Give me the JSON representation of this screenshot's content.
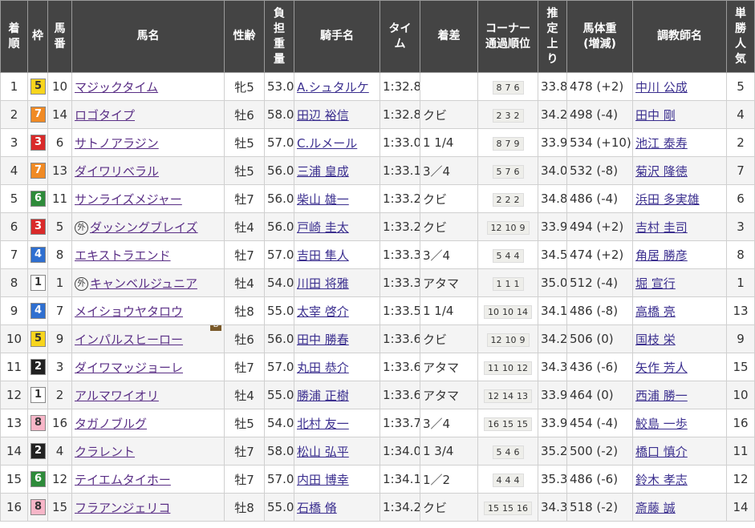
{
  "headers": {
    "rank": "着\n順",
    "waku": "枠",
    "umaban": "馬\n番",
    "horse": "馬名",
    "sexage": "性齢",
    "weight": "負\n担\n重\n量",
    "jockey": "騎手名",
    "time": "タイ\nム",
    "margin": "着差",
    "corner": "コーナー\n通過順位",
    "last3f": "推\n定\n上\nり",
    "bodyweight": "馬体重\n(増減)",
    "trainer": "調教師名",
    "pop": "単\n勝\n人\n気"
  },
  "waku_colors": {
    "1": {
      "bg": "#ffffff",
      "fg": "#333333"
    },
    "2": {
      "bg": "#222222",
      "fg": "#ffffff"
    },
    "3": {
      "bg": "#d92a2a",
      "fg": "#ffffff"
    },
    "4": {
      "bg": "#2f6fd0",
      "fg": "#ffffff"
    },
    "5": {
      "bg": "#f7d51d",
      "fg": "#333333"
    },
    "6": {
      "bg": "#2e8b3a",
      "fg": "#ffffff"
    },
    "7": {
      "bg": "#f08a24",
      "fg": "#ffffff"
    },
    "8": {
      "bg": "#f7b6c8",
      "fg": "#333333"
    }
  },
  "foreign_mark": "外",
  "blinker_mark": "B",
  "rows": [
    {
      "rank": "1",
      "waku": "5",
      "umaban": "10",
      "horse": "マジックタイム",
      "foreign": false,
      "blinker": false,
      "sexage": "牝5",
      "weight": "53.0",
      "jockey": "A.シュタルケ",
      "time": "1:32.8",
      "margin": "",
      "corner": [
        "8",
        "7",
        "6"
      ],
      "last3f": "33.8",
      "bodyweight": "478 (+2)",
      "trainer": "中川 公成",
      "pop": "5"
    },
    {
      "rank": "2",
      "waku": "7",
      "umaban": "14",
      "horse": "ロゴタイプ",
      "foreign": false,
      "blinker": false,
      "sexage": "牡6",
      "weight": "58.0",
      "jockey": "田辺 裕信",
      "time": "1:32.8",
      "margin": "クビ",
      "corner": [
        "2",
        "3",
        "2"
      ],
      "last3f": "34.2",
      "bodyweight": "498 (-4)",
      "trainer": "田中 剛",
      "pop": "4"
    },
    {
      "rank": "3",
      "waku": "3",
      "umaban": "6",
      "horse": "サトノアラジン",
      "foreign": false,
      "blinker": false,
      "sexage": "牡5",
      "weight": "57.0",
      "jockey": "C.ルメール",
      "time": "1:33.0",
      "margin": "1 1/4",
      "corner": [
        "8",
        "7",
        "9"
      ],
      "last3f": "33.9",
      "bodyweight": "534 (+10)",
      "trainer": "池江 泰寿",
      "pop": "2"
    },
    {
      "rank": "4",
      "waku": "7",
      "umaban": "13",
      "horse": "ダイワリベラル",
      "foreign": false,
      "blinker": false,
      "sexage": "牡5",
      "weight": "56.0",
      "jockey": "三浦 皇成",
      "time": "1:33.1",
      "margin": "3／4",
      "corner": [
        "5",
        "7",
        "6"
      ],
      "last3f": "34.0",
      "bodyweight": "532 (-8)",
      "trainer": "菊沢 隆徳",
      "pop": "7"
    },
    {
      "rank": "5",
      "waku": "6",
      "umaban": "11",
      "horse": "サンライズメジャー",
      "foreign": false,
      "blinker": false,
      "sexage": "牡7",
      "weight": "56.0",
      "jockey": "柴山 雄一",
      "time": "1:33.2",
      "margin": "クビ",
      "corner": [
        "2",
        "2",
        "2"
      ],
      "last3f": "34.8",
      "bodyweight": "486 (-4)",
      "trainer": "浜田 多実雄",
      "pop": "6"
    },
    {
      "rank": "6",
      "waku": "3",
      "umaban": "5",
      "horse": "ダッシングブレイズ",
      "foreign": true,
      "blinker": false,
      "sexage": "牡4",
      "weight": "56.0",
      "jockey": "戸崎 圭太",
      "time": "1:33.2",
      "margin": "クビ",
      "corner": [
        "12",
        "10",
        "9"
      ],
      "last3f": "33.9",
      "bodyweight": "494 (+2)",
      "trainer": "吉村 圭司",
      "pop": "3"
    },
    {
      "rank": "7",
      "waku": "4",
      "umaban": "8",
      "horse": "エキストラエンド",
      "foreign": false,
      "blinker": false,
      "sexage": "牡7",
      "weight": "57.0",
      "jockey": "吉田 隼人",
      "time": "1:33.3",
      "margin": "3／4",
      "corner": [
        "5",
        "4",
        "4"
      ],
      "last3f": "34.5",
      "bodyweight": "474 (+2)",
      "trainer": "角居 勝彦",
      "pop": "8"
    },
    {
      "rank": "8",
      "waku": "1",
      "umaban": "1",
      "horse": "キャンベルジュニア",
      "foreign": true,
      "blinker": false,
      "sexage": "牡4",
      "weight": "54.0",
      "jockey": "川田 将雅",
      "time": "1:33.3",
      "margin": "アタマ",
      "corner": [
        "1",
        "1",
        "1"
      ],
      "last3f": "35.0",
      "bodyweight": "512 (-4)",
      "trainer": "堀 宣行",
      "pop": "1"
    },
    {
      "rank": "9",
      "waku": "4",
      "umaban": "7",
      "horse": "メイショウヤタロウ",
      "foreign": false,
      "blinker": false,
      "sexage": "牡8",
      "weight": "55.0",
      "jockey": "太宰 啓介",
      "time": "1:33.5",
      "margin": "1 1/4",
      "corner": [
        "10",
        "10",
        "14"
      ],
      "last3f": "34.1",
      "bodyweight": "486 (-8)",
      "trainer": "高橋 亮",
      "pop": "13"
    },
    {
      "rank": "10",
      "waku": "5",
      "umaban": "9",
      "horse": "インパルスヒーロー",
      "foreign": false,
      "blinker": true,
      "sexage": "牡6",
      "weight": "56.0",
      "jockey": "田中 勝春",
      "time": "1:33.6",
      "margin": "クビ",
      "corner": [
        "12",
        "10",
        "9"
      ],
      "last3f": "34.2",
      "bodyweight": "506 (0)",
      "trainer": "国枝 栄",
      "pop": "9"
    },
    {
      "rank": "11",
      "waku": "2",
      "umaban": "3",
      "horse": "ダイワマッジョーレ",
      "foreign": false,
      "blinker": false,
      "sexage": "牡7",
      "weight": "57.0",
      "jockey": "丸田 恭介",
      "time": "1:33.6",
      "margin": "アタマ",
      "corner": [
        "11",
        "10",
        "12"
      ],
      "last3f": "34.3",
      "bodyweight": "436 (-6)",
      "trainer": "矢作 芳人",
      "pop": "15"
    },
    {
      "rank": "12",
      "waku": "1",
      "umaban": "2",
      "horse": "アルマワイオリ",
      "foreign": false,
      "blinker": false,
      "sexage": "牡4",
      "weight": "55.0",
      "jockey": "勝浦 正樹",
      "time": "1:33.6",
      "margin": "アタマ",
      "corner": [
        "12",
        "14",
        "13"
      ],
      "last3f": "33.9",
      "bodyweight": "464 (0)",
      "trainer": "西浦 勝一",
      "pop": "10"
    },
    {
      "rank": "13",
      "waku": "8",
      "umaban": "16",
      "horse": "タガノブルグ",
      "foreign": false,
      "blinker": false,
      "sexage": "牡5",
      "weight": "54.0",
      "jockey": "北村 友一",
      "time": "1:33.7",
      "margin": "3／4",
      "corner": [
        "16",
        "15",
        "15"
      ],
      "last3f": "33.9",
      "bodyweight": "454 (-4)",
      "trainer": "鮫島 一歩",
      "pop": "16"
    },
    {
      "rank": "14",
      "waku": "2",
      "umaban": "4",
      "horse": "クラレント",
      "foreign": false,
      "blinker": false,
      "sexage": "牡7",
      "weight": "58.0",
      "jockey": "松山 弘平",
      "time": "1:34.0",
      "margin": "1 3/4",
      "corner": [
        "5",
        "4",
        "6"
      ],
      "last3f": "35.2",
      "bodyweight": "500 (-2)",
      "trainer": "橋口 慎介",
      "pop": "11"
    },
    {
      "rank": "15",
      "waku": "6",
      "umaban": "12",
      "horse": "テイエムタイホー",
      "foreign": false,
      "blinker": false,
      "sexage": "牡7",
      "weight": "57.0",
      "jockey": "内田 博幸",
      "time": "1:34.1",
      "margin": "1／2",
      "corner": [
        "4",
        "4",
        "4"
      ],
      "last3f": "35.3",
      "bodyweight": "486 (-6)",
      "trainer": "鈴木 孝志",
      "pop": "12"
    },
    {
      "rank": "16",
      "waku": "8",
      "umaban": "15",
      "horse": "フラアンジェリコ",
      "foreign": false,
      "blinker": false,
      "sexage": "牡8",
      "weight": "55.0",
      "jockey": "石橋 脩",
      "time": "1:34.2",
      "margin": "クビ",
      "corner": [
        "15",
        "15",
        "16"
      ],
      "last3f": "34.3",
      "bodyweight": "518 (-2)",
      "trainer": "斎藤 誠",
      "pop": "14"
    }
  ]
}
